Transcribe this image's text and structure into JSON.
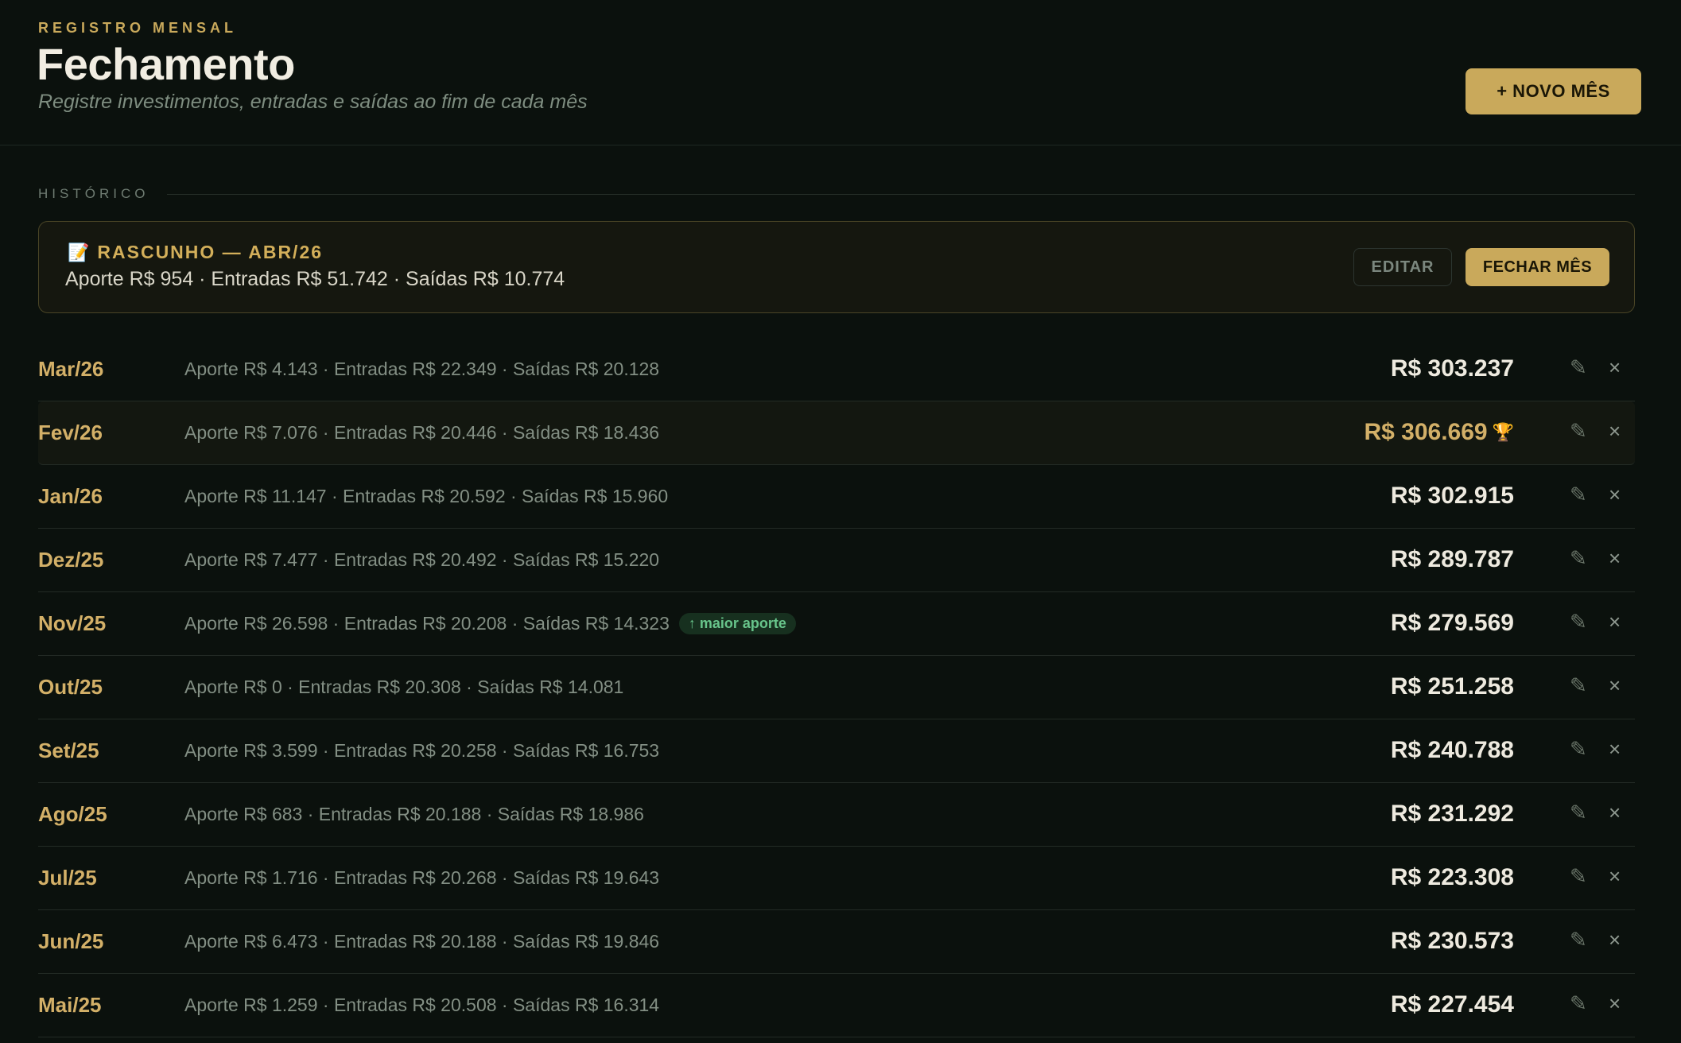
{
  "header": {
    "eyebrow": "REGISTRO MENSAL",
    "title": "Fechamento",
    "subtitle": "Registre investimentos, entradas e saídas ao fim de cada mês",
    "new_month_label": "+ NOVO MÊS"
  },
  "history": {
    "section_label": "HISTÓRICO",
    "draft": {
      "icon": "memo-icon",
      "title": "RASCUNHO — ABR/26",
      "summary": "Aporte R$ 954 · Entradas R$ 51.742 · Saídas R$ 10.774",
      "edit_label": "EDITAR",
      "close_label": "FECHAR MÊS"
    },
    "rows": [
      {
        "month": "Mar/26",
        "details": "Aporte R$ 4.143 · Entradas R$ 22.349 · Saídas R$ 20.128",
        "total": "R$ 303.237"
      },
      {
        "month": "Fev/26",
        "details": "Aporte R$ 7.076 · Entradas R$ 20.446 · Saídas R$ 18.436",
        "total": "R$ 306.669",
        "highlight": true
      },
      {
        "month": "Jan/26",
        "details": "Aporte R$ 11.147 · Entradas R$ 20.592 · Saídas R$ 15.960",
        "total": "R$ 302.915"
      },
      {
        "month": "Dez/25",
        "details": "Aporte R$ 7.477 · Entradas R$ 20.492 · Saídas R$ 15.220",
        "total": "R$ 289.787"
      },
      {
        "month": "Nov/25",
        "details": "Aporte R$ 26.598 · Entradas R$ 20.208 · Saídas R$ 14.323",
        "total": "R$ 279.569",
        "badge": "↑ maior aporte"
      },
      {
        "month": "Out/25",
        "details": "Aporte R$ 0 · Entradas R$ 20.308 · Saídas R$ 14.081",
        "total": "R$ 251.258"
      },
      {
        "month": "Set/25",
        "details": "Aporte R$ 3.599 · Entradas R$ 20.258 · Saídas R$ 16.753",
        "total": "R$ 240.788"
      },
      {
        "month": "Ago/25",
        "details": "Aporte R$ 683 · Entradas R$ 20.188 · Saídas R$ 18.986",
        "total": "R$ 231.292"
      },
      {
        "month": "Jul/25",
        "details": "Aporte R$ 1.716 · Entradas R$ 20.268 · Saídas R$ 19.643",
        "total": "R$ 223.308"
      },
      {
        "month": "Jun/25",
        "details": "Aporte R$ 6.473 · Entradas R$ 20.188 · Saídas R$ 19.846",
        "total": "R$ 230.573"
      },
      {
        "month": "Mai/25",
        "details": "Aporte R$ 1.259 · Entradas R$ 20.508 · Saídas R$ 16.314",
        "total": "R$ 227.454"
      }
    ],
    "row_icons": {
      "edit": "pencil-icon",
      "delete": "close-icon",
      "best": "trophy-icon"
    }
  },
  "colors": {
    "background": "#0b110d",
    "accent_gold": "#c9a95b",
    "badge_green": "#68c58b"
  }
}
